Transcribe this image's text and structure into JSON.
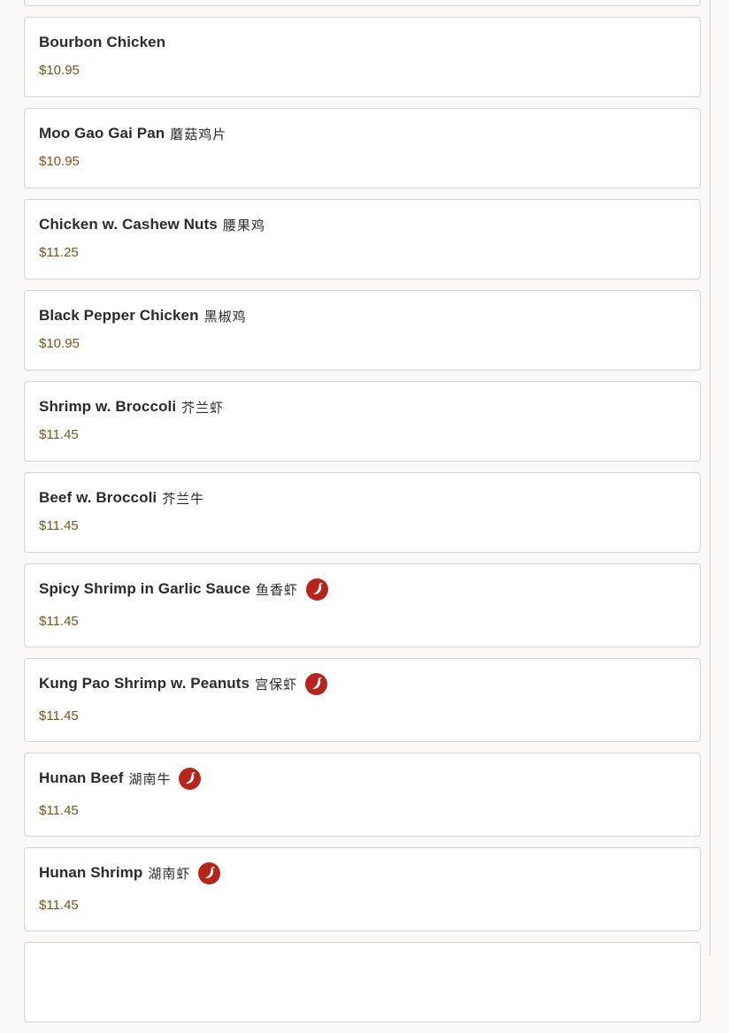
{
  "menu_items": [
    {
      "name": "",
      "chinese": "",
      "price": "",
      "spicy": false
    },
    {
      "name": "Bourbon Chicken",
      "chinese": "",
      "price": "$10.95",
      "spicy": false
    },
    {
      "name": "Moo Gao Gai Pan",
      "chinese": "蘑菇鸡片",
      "price": "$10.95",
      "spicy": false
    },
    {
      "name": "Chicken w. Cashew Nuts",
      "chinese": "腰果鸡",
      "price": "$11.25",
      "spicy": false
    },
    {
      "name": "Black Pepper Chicken",
      "chinese": "黑椒鸡",
      "price": "$10.95",
      "spicy": false
    },
    {
      "name": "Shrimp w. Broccoli",
      "chinese": "芥兰虾",
      "price": "$11.45",
      "spicy": false
    },
    {
      "name": "Beef w. Broccoli",
      "chinese": "芥兰牛",
      "price": "$11.45",
      "spicy": false
    },
    {
      "name": "Spicy Shrimp in Garlic Sauce",
      "chinese": "鱼香虾",
      "price": "$11.45",
      "spicy": true
    },
    {
      "name": "Kung Pao Shrimp w. Peanuts",
      "chinese": "宫保虾",
      "price": "$11.45",
      "spicy": true
    },
    {
      "name": "Hunan Beef",
      "chinese": "湖南牛",
      "price": "$11.45",
      "spicy": true
    },
    {
      "name": "Hunan Shrimp",
      "chinese": "湖南虾",
      "price": "$11.45",
      "spicy": true
    },
    {
      "name": "",
      "chinese": "",
      "price": "",
      "spicy": false
    }
  ],
  "icons": {
    "spicy": "chili-pepper-icon"
  },
  "colors": {
    "price": "#7a5418",
    "spicy_badge": "#b5251c",
    "card_border": "#d3d3d3"
  }
}
